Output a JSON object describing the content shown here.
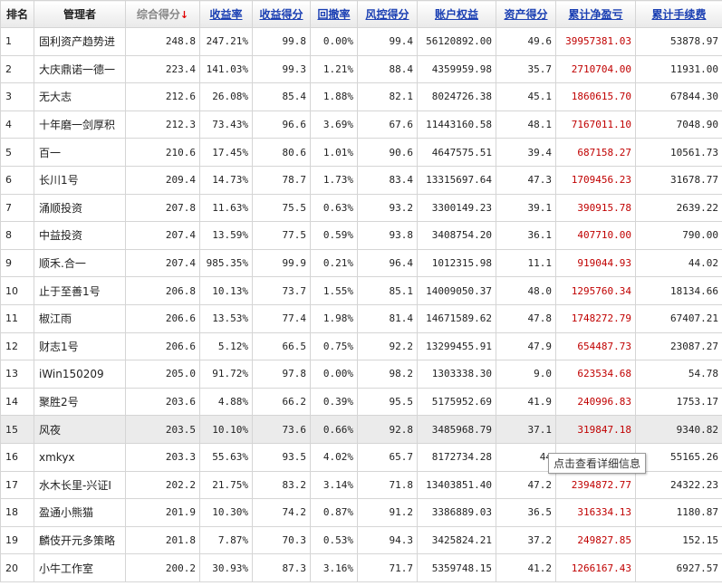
{
  "header": {
    "rank": "排名",
    "manager": "管理者",
    "composite": "综合得分",
    "sort_arrow": "↓",
    "return_rate": "收益率",
    "return_score": "收益得分",
    "drawdown": "回撤率",
    "risk_score": "风控得分",
    "equity": "账户权益",
    "asset_score": "资产得分",
    "net_pnl": "累计净盈亏",
    "fees": "累计手续费"
  },
  "rows": [
    {
      "rank": "1",
      "manager": "固利资产趋势进",
      "composite": "248.8",
      "return_rate": "247.21%",
      "return_score": "99.8",
      "drawdown": "0.00%",
      "risk_score": "99.4",
      "equity": "56120892.00",
      "asset_score": "49.6",
      "net_pnl": "39957381.03",
      "fees": "53878.97"
    },
    {
      "rank": "2",
      "manager": "大庆鼎诺一德一",
      "composite": "223.4",
      "return_rate": "141.03%",
      "return_score": "99.3",
      "drawdown": "1.21%",
      "risk_score": "88.4",
      "equity": "4359959.98",
      "asset_score": "35.7",
      "net_pnl": "2710704.00",
      "fees": "11931.00"
    },
    {
      "rank": "3",
      "manager": "无大志",
      "composite": "212.6",
      "return_rate": "26.08%",
      "return_score": "85.4",
      "drawdown": "1.88%",
      "risk_score": "82.1",
      "equity": "8024726.38",
      "asset_score": "45.1",
      "net_pnl": "1860615.70",
      "fees": "67844.30"
    },
    {
      "rank": "4",
      "manager": "十年磨一剑厚积",
      "composite": "212.3",
      "return_rate": "73.43%",
      "return_score": "96.6",
      "drawdown": "3.69%",
      "risk_score": "67.6",
      "equity": "11443160.58",
      "asset_score": "48.1",
      "net_pnl": "7167011.10",
      "fees": "7048.90"
    },
    {
      "rank": "5",
      "manager": "百一",
      "composite": "210.6",
      "return_rate": "17.45%",
      "return_score": "80.6",
      "drawdown": "1.01%",
      "risk_score": "90.6",
      "equity": "4647575.51",
      "asset_score": "39.4",
      "net_pnl": "687158.27",
      "fees": "10561.73"
    },
    {
      "rank": "6",
      "manager": "长川1号",
      "composite": "209.4",
      "return_rate": "14.73%",
      "return_score": "78.7",
      "drawdown": "1.73%",
      "risk_score": "83.4",
      "equity": "13315697.64",
      "asset_score": "47.3",
      "net_pnl": "1709456.23",
      "fees": "31678.77"
    },
    {
      "rank": "7",
      "manager": "涌顺投资",
      "composite": "207.8",
      "return_rate": "11.63%",
      "return_score": "75.5",
      "drawdown": "0.63%",
      "risk_score": "93.2",
      "equity": "3300149.23",
      "asset_score": "39.1",
      "net_pnl": "390915.78",
      "fees": "2639.22"
    },
    {
      "rank": "8",
      "manager": "中益投资",
      "composite": "207.4",
      "return_rate": "13.59%",
      "return_score": "77.5",
      "drawdown": "0.59%",
      "risk_score": "93.8",
      "equity": "3408754.20",
      "asset_score": "36.1",
      "net_pnl": "407710.00",
      "fees": "790.00"
    },
    {
      "rank": "9",
      "manager": "顺禾.合一",
      "composite": "207.4",
      "return_rate": "985.35%",
      "return_score": "99.9",
      "drawdown": "0.21%",
      "risk_score": "96.4",
      "equity": "1012315.98",
      "asset_score": "11.1",
      "net_pnl": "919044.93",
      "fees": "44.02"
    },
    {
      "rank": "10",
      "manager": "止于至善1号",
      "composite": "206.8",
      "return_rate": "10.13%",
      "return_score": "73.7",
      "drawdown": "1.55%",
      "risk_score": "85.1",
      "equity": "14009050.37",
      "asset_score": "48.0",
      "net_pnl": "1295760.34",
      "fees": "18134.66"
    },
    {
      "rank": "11",
      "manager": "椒江雨",
      "composite": "206.6",
      "return_rate": "13.53%",
      "return_score": "77.4",
      "drawdown": "1.98%",
      "risk_score": "81.4",
      "equity": "14671589.62",
      "asset_score": "47.8",
      "net_pnl": "1748272.79",
      "fees": "67407.21"
    },
    {
      "rank": "12",
      "manager": "财志1号",
      "composite": "206.6",
      "return_rate": "5.12%",
      "return_score": "66.5",
      "drawdown": "0.75%",
      "risk_score": "92.2",
      "equity": "13299455.91",
      "asset_score": "47.9",
      "net_pnl": "654487.73",
      "fees": "23087.27"
    },
    {
      "rank": "13",
      "manager": "iWin150209",
      "composite": "205.0",
      "return_rate": "91.72%",
      "return_score": "97.8",
      "drawdown": "0.00%",
      "risk_score": "98.2",
      "equity": "1303338.30",
      "asset_score": "9.0",
      "net_pnl": "623534.68",
      "fees": "54.78"
    },
    {
      "rank": "14",
      "manager": "聚胜2号",
      "composite": "203.6",
      "return_rate": "4.88%",
      "return_score": "66.2",
      "drawdown": "0.39%",
      "risk_score": "95.5",
      "equity": "5175952.69",
      "asset_score": "41.9",
      "net_pnl": "240996.83",
      "fees": "1753.17"
    },
    {
      "rank": "15",
      "manager": "风夜",
      "composite": "203.5",
      "return_rate": "10.10%",
      "return_score": "73.6",
      "drawdown": "0.66%",
      "risk_score": "92.8",
      "equity": "3485968.79",
      "asset_score": "37.1",
      "net_pnl": "319847.18",
      "fees": "9340.82"
    },
    {
      "rank": "16",
      "manager": "xmkyx",
      "composite": "203.3",
      "return_rate": "55.63%",
      "return_score": "93.5",
      "drawdown": "4.02%",
      "risk_score": "65.7",
      "equity": "8172734.28",
      "asset_score": "44",
      "net_pnl": "",
      "fees": "55165.26"
    },
    {
      "rank": "17",
      "manager": "水木长里-兴证I",
      "composite": "202.2",
      "return_rate": "21.75%",
      "return_score": "83.2",
      "drawdown": "3.14%",
      "risk_score": "71.8",
      "equity": "13403851.40",
      "asset_score": "47.2",
      "net_pnl": "2394872.77",
      "fees": "24322.23"
    },
    {
      "rank": "18",
      "manager": "盈通小熊猫",
      "composite": "201.9",
      "return_rate": "10.30%",
      "return_score": "74.2",
      "drawdown": "0.87%",
      "risk_score": "91.2",
      "equity": "3386889.03",
      "asset_score": "36.5",
      "net_pnl": "316334.13",
      "fees": "1180.87"
    },
    {
      "rank": "19",
      "manager": "麟伎开元多策略",
      "composite": "201.8",
      "return_rate": "7.87%",
      "return_score": "70.3",
      "drawdown": "0.53%",
      "risk_score": "94.3",
      "equity": "3425824.21",
      "asset_score": "37.2",
      "net_pnl": "249827.85",
      "fees": "152.15"
    },
    {
      "rank": "20",
      "manager": "小牛工作室",
      "composite": "200.2",
      "return_rate": "30.93%",
      "return_score": "87.3",
      "drawdown": "3.16%",
      "risk_score": "71.7",
      "equity": "5359748.15",
      "asset_score": "41.2",
      "net_pnl": "1266167.43",
      "fees": "6927.57"
    }
  ],
  "highlighted_row": "15",
  "tooltip": "点击查看详细信息",
  "colors": {
    "link": "#1a3fb3",
    "pnl": "#c00000",
    "highlight": "#ebebeb",
    "border": "#d5d5d5"
  }
}
